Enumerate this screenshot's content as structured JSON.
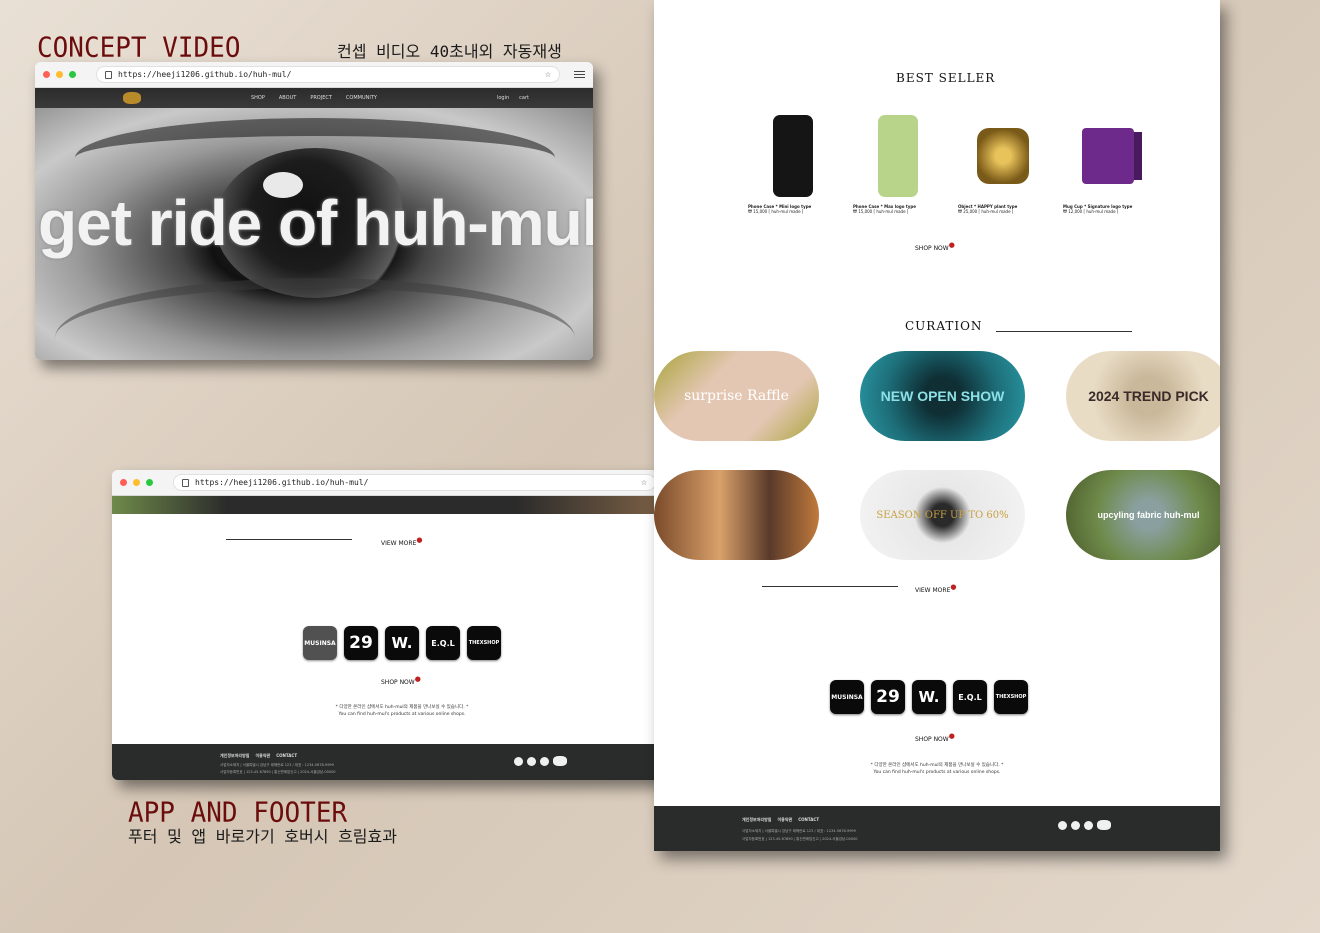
{
  "headings": {
    "concept_title": "CONCEPT VIDEO",
    "concept_sub": "컨셉 비디오 40초내외 자동재생",
    "app_title": "APP AND FOOTER",
    "app_sub": "푸터 및 앱 바로가기 호버시 흐림효과"
  },
  "browser": {
    "url": "https://heeji1206.github.io/huh-mul/",
    "url2": "https://heeji1206.github.io/huh-mul/"
  },
  "nav": {
    "items": [
      "SHOP",
      "ABOUT",
      "PROJECT",
      "COMMUNITY"
    ],
    "right": [
      "login",
      "cart"
    ]
  },
  "video": {
    "text": "get ride of huh-mul"
  },
  "best": {
    "title": "BEST SELLER",
    "products": [
      {
        "name": "Phone Case * Mini logo type",
        "price": "₩ 15,000 [ huh-mul made ]",
        "color": "#151515"
      },
      {
        "name": "Phone Case * Max logo type",
        "price": "₩ 15,000 [ huh-mul made ]",
        "color": "#b8d38a"
      },
      {
        "name": "Object * HAPPY plant type",
        "price": "₩ 25,000 [ huh-mul made ]",
        "color": "#b88a2a"
      },
      {
        "name": "Mug Cup * Signature logo type",
        "price": "₩ 12,000 [ huh-mul made ]",
        "color": "#6e2a8a"
      }
    ],
    "shop_now": "SHOP NOW"
  },
  "curation": {
    "title": "CURATION",
    "cards": [
      {
        "label": "surprise Raffle",
        "bg": "#e4c7b3"
      },
      {
        "label": "NEW OPEN SHOW",
        "bg": "#1d6f7a"
      },
      {
        "label": "2024 TREND PICK",
        "bg": "#e9dcc5"
      },
      {
        "label": "",
        "bg": "#c07a3c"
      },
      {
        "label": "SEASON OFF UP TO 60%",
        "bg": "#e8e8e8"
      },
      {
        "label": "upcyling fabric huh-mul",
        "bg": "#6e8a4a"
      }
    ],
    "view_more": "VIEW MORE"
  },
  "apps": [
    "MUSINSA",
    "29",
    "W.",
    "E.Q.L",
    "THEXSHOP"
  ],
  "shop_now2": "SHOP NOW",
  "note": {
    "kr": "* 다양한 온라인 샵에서도 huh-mul의 제품을 만나보실 수 있습니다. *",
    "en": "You can find huh-mul's products at various online shops."
  },
  "footer": {
    "links": [
      "개인정보처리방침",
      "이용약관",
      "CONTACT"
    ],
    "info1": "사업자소재지 | 서울특별시 강남구 테헤란로 123 / 대표 : 1234-5678-9999",
    "info2": "사업자등록번호 | 123-45-67890 | 통신판매업신고 | 2024-서울강남-00000"
  }
}
